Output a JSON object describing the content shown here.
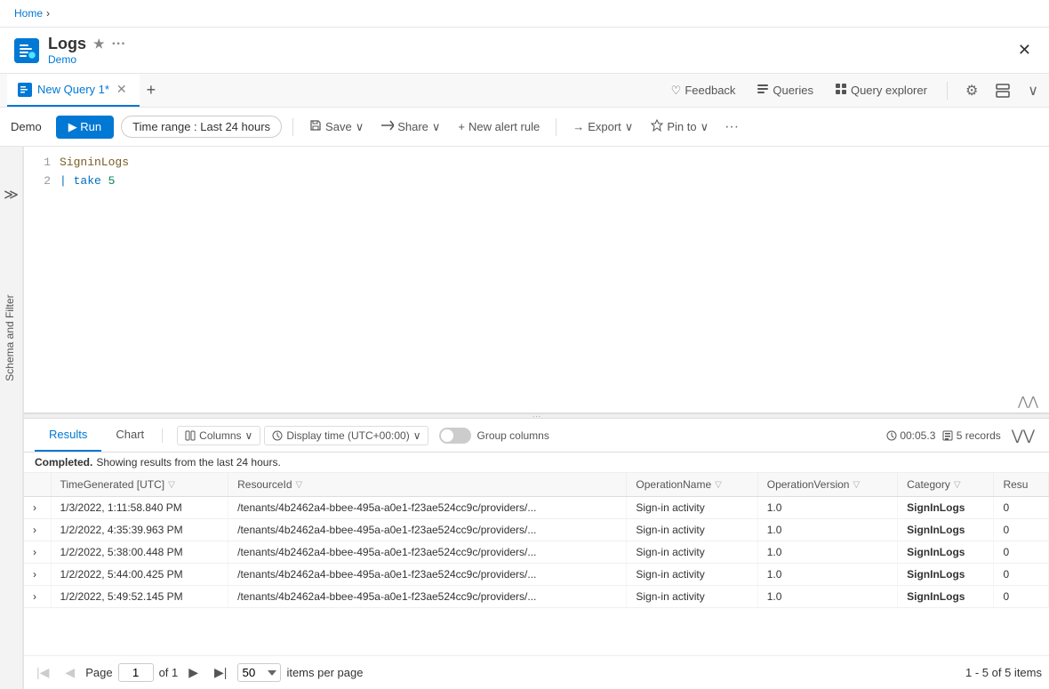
{
  "breadcrumb": {
    "home": "Home",
    "separator": "›"
  },
  "header": {
    "app_name": "Logs",
    "workspace": "Demo",
    "star_label": "★",
    "more_label": "···",
    "close_label": "✕"
  },
  "tabs": {
    "items": [
      {
        "label": "New Query 1*",
        "active": true
      },
      {
        "label": "+",
        "active": false
      }
    ],
    "actions": [
      {
        "label": "Feedback",
        "icon": "♡"
      },
      {
        "label": "Queries",
        "icon": "≡"
      },
      {
        "label": "Query explorer",
        "icon": "⊞"
      },
      {
        "label": "⚙",
        "icon": "⚙"
      },
      {
        "label": "⊞",
        "icon": "⊞"
      },
      {
        "label": "∨",
        "icon": "∨"
      }
    ]
  },
  "toolbar": {
    "workspace_label": "Demo",
    "run_label": "▶ Run",
    "time_range_label": "Time range : Last 24 hours",
    "save_label": "Save",
    "share_label": "Share",
    "alert_label": "New alert rule",
    "export_label": "Export",
    "pin_label": "Pin to",
    "more_label": "···"
  },
  "editor": {
    "lines": [
      {
        "num": "1",
        "content": "SigninLogs"
      },
      {
        "num": "2",
        "content": "| take 5"
      }
    ],
    "collapse_icon": "⋀⋀"
  },
  "results": {
    "tabs": [
      {
        "label": "Results",
        "active": true
      },
      {
        "label": "Chart",
        "active": false
      }
    ],
    "columns_btn": "Columns",
    "display_time_btn": "Display time (UTC+00:00)",
    "group_columns_label": "Group columns",
    "status_text": "Completed.",
    "status_detail": "Showing results from the last 24 hours.",
    "timer": "00:05.3",
    "records": "5 records",
    "expand_icon": "⋁⋁",
    "columns": [
      {
        "label": "TimeGenerated [UTC]"
      },
      {
        "label": "ResourceId"
      },
      {
        "label": "OperationName"
      },
      {
        "label": "OperationVersion"
      },
      {
        "label": "Category"
      },
      {
        "label": "Resu"
      }
    ],
    "rows": [
      {
        "time": "1/3/2022, 1:11:58.840 PM",
        "resource": "/tenants/4b2462a4-bbee-495a-a0e1-f23ae524cc9c/providers/...",
        "operation": "Sign-in activity",
        "version": "1.0",
        "category": "SignInLogs",
        "result": "0"
      },
      {
        "time": "1/2/2022, 4:35:39.963 PM",
        "resource": "/tenants/4b2462a4-bbee-495a-a0e1-f23ae524cc9c/providers/...",
        "operation": "Sign-in activity",
        "version": "1.0",
        "category": "SignInLogs",
        "result": "0"
      },
      {
        "time": "1/2/2022, 5:38:00.448 PM",
        "resource": "/tenants/4b2462a4-bbee-495a-a0e1-f23ae524cc9c/providers/...",
        "operation": "Sign-in activity",
        "version": "1.0",
        "category": "SignInLogs",
        "result": "0"
      },
      {
        "time": "1/2/2022, 5:44:00.425 PM",
        "resource": "/tenants/4b2462a4-bbee-495a-a0e1-f23ae524cc9c/providers/...",
        "operation": "Sign-in activity",
        "version": "1.0",
        "category": "SignInLogs",
        "result": "0"
      },
      {
        "time": "1/2/2022, 5:49:52.145 PM",
        "resource": "/tenants/4b2462a4-bbee-495a-a0e1-f23ae524cc9c/providers/...",
        "operation": "Sign-in activity",
        "version": "1.0",
        "category": "SignInLogs",
        "result": "0"
      }
    ]
  },
  "pagination": {
    "page_label": "Page",
    "of_label": "of 1",
    "page_value": "1",
    "per_page_value": "50",
    "items_label": "items per page",
    "summary": "1 - 5 of 5 items"
  },
  "sidebar": {
    "label": "Schema and Filter"
  }
}
